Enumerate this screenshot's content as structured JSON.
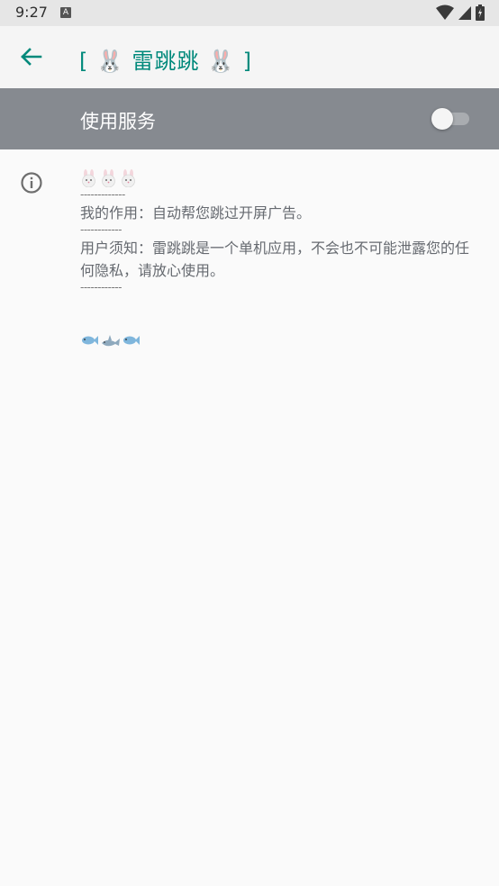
{
  "status": {
    "time": "9:27",
    "notification_icon": "A"
  },
  "app_bar": {
    "title": "[ 🐰 雷跳跳 🐰 ]"
  },
  "service": {
    "label": "使用服务",
    "enabled": false
  },
  "info": {
    "separator": "-------------",
    "separator2": "------------",
    "separator3": "------------",
    "usage": "我的作用：自动帮您跳过开屏广告。",
    "notice": "用户须知：雷跳跳是一个单机应用，不会也不可能泄露您的任何隐私，请放心使用。"
  }
}
